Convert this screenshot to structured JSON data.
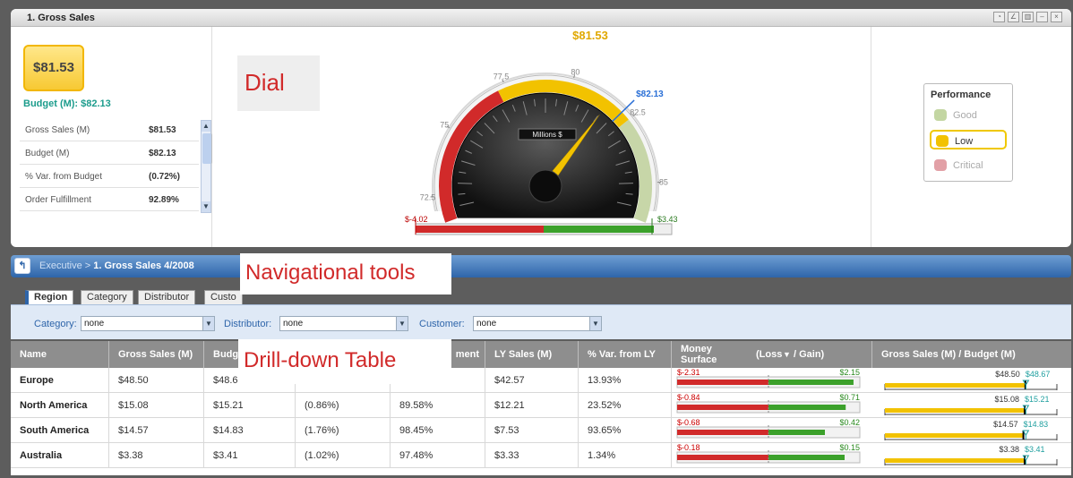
{
  "panel": {
    "title": "1. Gross Sales",
    "value": "$81.53",
    "budget_label": "Budget (M): $82.13",
    "stats": [
      {
        "label": "Gross Sales (M)",
        "value": "$81.53"
      },
      {
        "label": "Budget (M)",
        "value": "$82.13"
      },
      {
        "label": "% Var. from Budget",
        "value": "(0.72%)"
      },
      {
        "label": "Order Fulfillment",
        "value": "92.89%"
      }
    ],
    "annotation_dial": "Dial"
  },
  "gauge": {
    "current_value": 81.53,
    "current_label": "$81.53",
    "budget_value": 82.13,
    "budget_label": "$82.13",
    "center_label": "Millions $",
    "min": 71.5,
    "max": 86.5,
    "ticks": [
      "72.5",
      "75",
      "77.5",
      "80",
      "82.5",
      "85"
    ],
    "tick_values": [
      72.5,
      75,
      77.5,
      80,
      82.5,
      85
    ],
    "bands": [
      {
        "from": 71.5,
        "to": 77.2,
        "color": "#d12a2a"
      },
      {
        "from": 77.2,
        "to": 82.5,
        "color": "#f2c200"
      },
      {
        "from": 82.5,
        "to": 86.5,
        "color": "#c7d6a8"
      }
    ],
    "variance_min": "$-4.02",
    "variance_max": "$3.43"
  },
  "performance": {
    "title": "Performance",
    "items": [
      {
        "label": "Good",
        "color": "#c3d6a2"
      },
      {
        "label": "Low",
        "color": "#f2c200"
      },
      {
        "label": "Critical",
        "color": "#e2a0a6"
      }
    ]
  },
  "breadcrumb": {
    "parent": "Executive >",
    "current": "1. Gross Sales 4/2008"
  },
  "annotation_nav": "Navigational tools",
  "annotation_drill": "Drill-down Table",
  "tabs": [
    "Region",
    "Category",
    "Distributor",
    "Custo"
  ],
  "filters": [
    {
      "label": "Category:",
      "value": "none"
    },
    {
      "label": "Distributor:",
      "value": "none"
    },
    {
      "label": "Customer:",
      "value": "none"
    }
  ],
  "table": {
    "headers": [
      "Name",
      "Gross Sales (M)",
      "Budg",
      "",
      "ment",
      "LY Sales (M)",
      "% Var. from LY",
      "Money Surface",
      "(Loss",
      "/ Gain)",
      "Gross Sales (M) / Budget (M)"
    ],
    "rows": [
      {
        "name": "Europe",
        "gross": "$48.50",
        "budget": "$48.67",
        "var": "",
        "ful": "",
        "ly": "$42.57",
        "varly": "13.93%",
        "loss": "$-2.31",
        "gain": "$2.15",
        "loss_v": -2.31,
        "gain_v": 2.15,
        "g_lab": "$48.50",
        "b_lab": "$48.67",
        "g_v": 48.5,
        "b_v": 48.67
      },
      {
        "name": "North America",
        "gross": "$15.08",
        "budget": "$15.21",
        "var": "(0.86%)",
        "ful": "89.58%",
        "ly": "$12.21",
        "varly": "23.52%",
        "loss": "$-0.84",
        "gain": "$0.71",
        "loss_v": -0.84,
        "gain_v": 0.71,
        "g_lab": "$15.08",
        "b_lab": "$15.21",
        "g_v": 15.08,
        "b_v": 15.21
      },
      {
        "name": "South America",
        "gross": "$14.57",
        "budget": "$14.83",
        "var": "(1.76%)",
        "ful": "98.45%",
        "ly": "$7.53",
        "varly": "93.65%",
        "loss": "$-0.68",
        "gain": "$0.42",
        "loss_v": -0.68,
        "gain_v": 0.42,
        "g_lab": "$14.57",
        "b_lab": "$14.83",
        "g_v": 14.57,
        "b_v": 14.83
      },
      {
        "name": "Australia",
        "gross": "$3.38",
        "budget": "$3.41",
        "var": "(1.02%)",
        "ful": "97.48%",
        "ly": "$3.33",
        "varly": "1.34%",
        "loss": "$-0.18",
        "gain": "$0.15",
        "loss_v": -0.18,
        "gain_v": 0.15,
        "g_lab": "$3.38",
        "b_lab": "$3.41",
        "g_v": 3.38,
        "b_v": 3.41
      }
    ]
  }
}
